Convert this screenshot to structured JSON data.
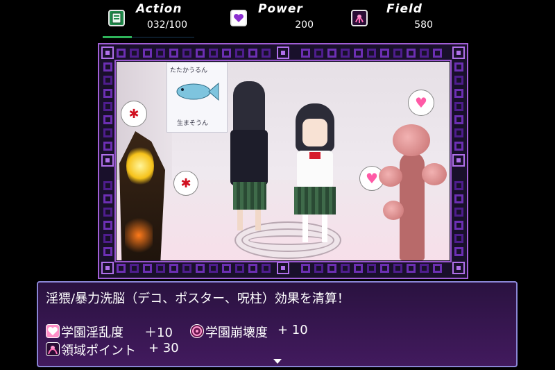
{
  "hud": {
    "action": {
      "label": "Action",
      "value": "032/100",
      "progress": 0.32,
      "icon": "book-icon"
    },
    "power": {
      "label": "Power",
      "value": "200",
      "icon": "heart-icon"
    },
    "field": {
      "label": "Field",
      "value": "580",
      "icon": "tentacle-emblem-icon"
    }
  },
  "dialog": {
    "line1": "淫猥/暴力洗脳（デコ、ポスター、呪柱）効果を清算！",
    "stats": [
      {
        "icon": "heart-pink-icon",
        "label": "学園淫乱度",
        "value": "＋10"
      },
      {
        "icon": "collapse-swirl-icon",
        "label": "学園崩壊度",
        "value": "+ 10"
      },
      {
        "icon": "tentacle-emblem-icon",
        "label": "領域ポイント",
        "value": "+ 30"
      }
    ]
  },
  "scene": {
    "poster_text_top": "たたかうるん",
    "poster_text_bottom": "生まそうん"
  },
  "colors": {
    "accent": "#a15fd6",
    "action_bar": "#2fb35a",
    "dialog_border": "#8a86d6"
  }
}
